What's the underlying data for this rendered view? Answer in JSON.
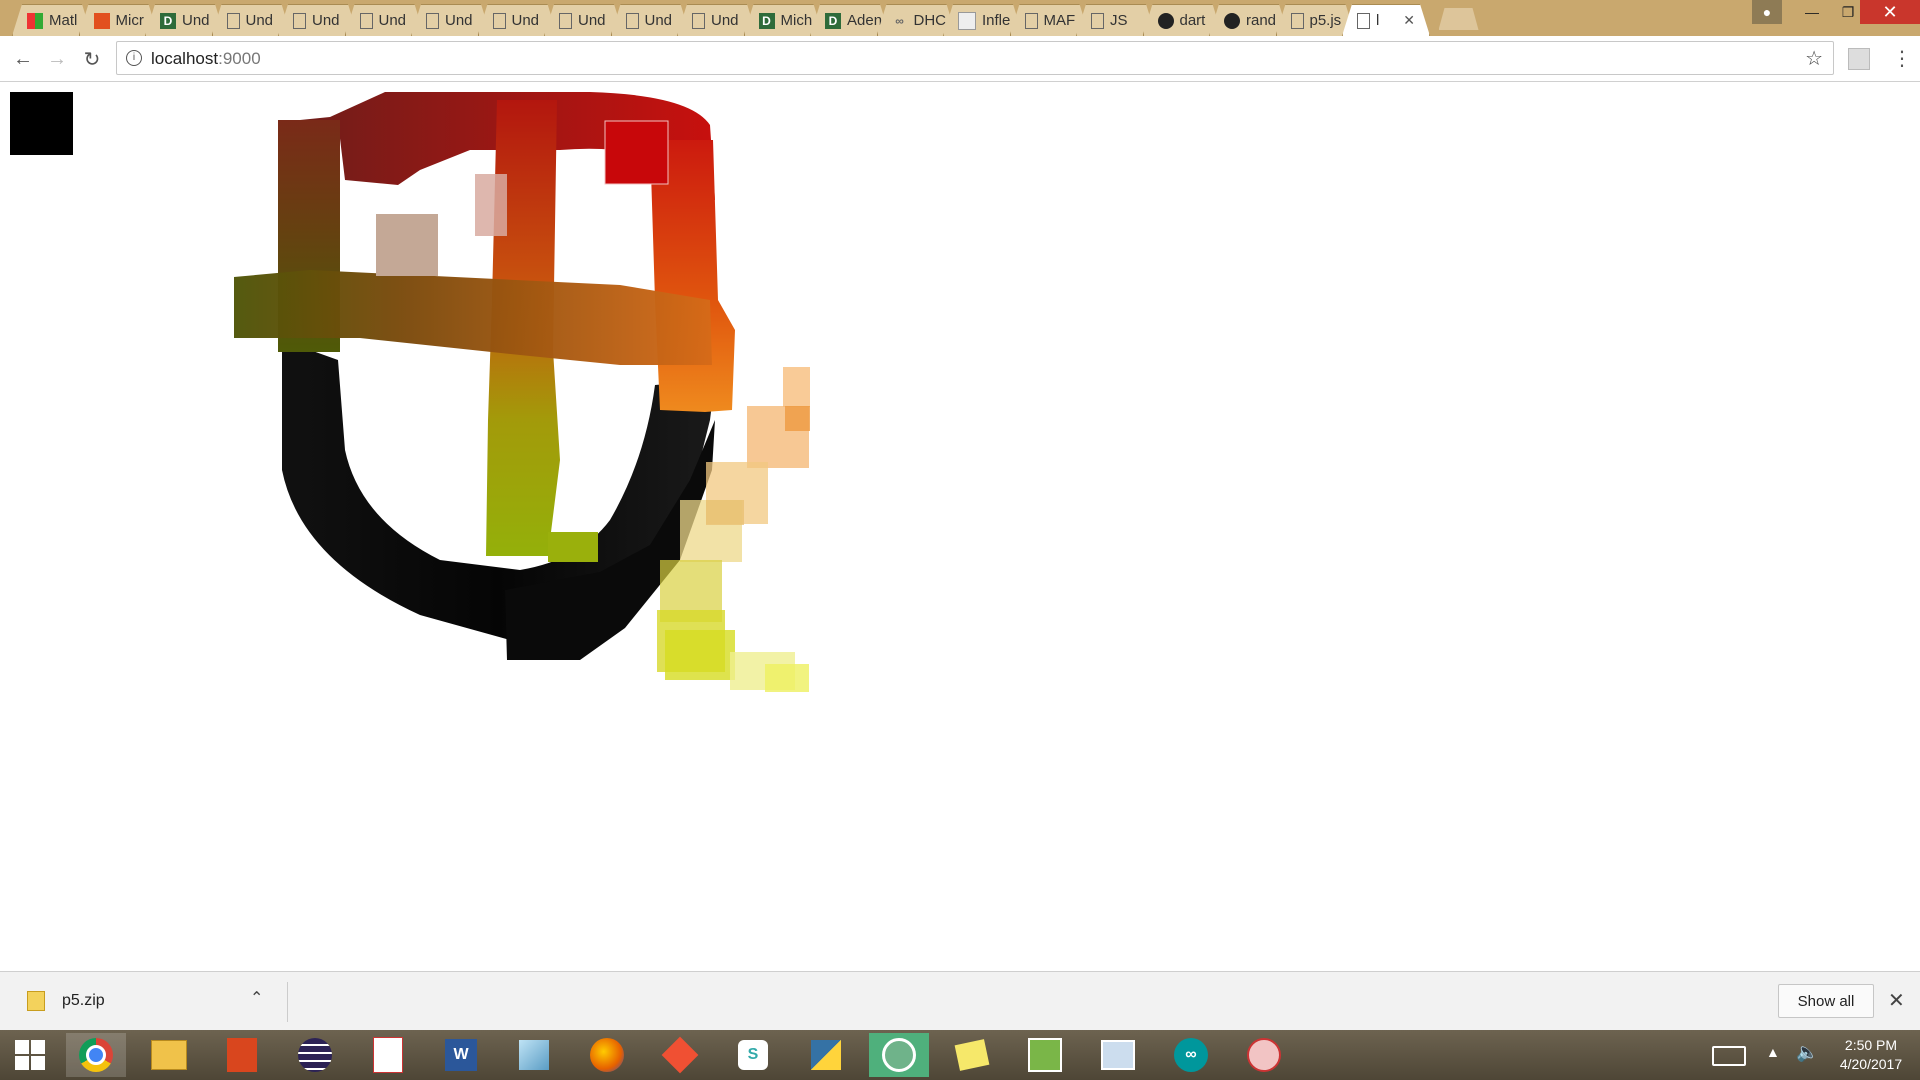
{
  "tabs": [
    {
      "label": "Matl",
      "icon": "multicolor-grid-icon",
      "color": "#d23b2a"
    },
    {
      "label": "Micr",
      "icon": "office-icon",
      "color": "#e2501f"
    },
    {
      "label": "Und",
      "icon": "d-icon",
      "color": "#2e6b3a"
    },
    {
      "label": "Und",
      "icon": "page-icon",
      "color": "#666666"
    },
    {
      "label": "Und",
      "icon": "page-icon",
      "color": "#666666"
    },
    {
      "label": "Und",
      "icon": "page-icon",
      "color": "#666666"
    },
    {
      "label": "Und",
      "icon": "page-icon",
      "color": "#666666"
    },
    {
      "label": "Und",
      "icon": "page-icon",
      "color": "#666666"
    },
    {
      "label": "Und",
      "icon": "page-icon",
      "color": "#666666"
    },
    {
      "label": "Und",
      "icon": "page-icon",
      "color": "#666666"
    },
    {
      "label": "Und",
      "icon": "page-icon",
      "color": "#666666"
    },
    {
      "label": "Mich",
      "icon": "d-icon",
      "color": "#2e6b3a"
    },
    {
      "label": "Aden",
      "icon": "d-icon",
      "color": "#2e6b3a"
    },
    {
      "label": "DHC",
      "icon": "link-icon",
      "color": "#666666"
    },
    {
      "label": "Infle",
      "icon": "image-icon",
      "color": "#999999"
    },
    {
      "label": "MAF",
      "icon": "page-icon",
      "color": "#666666"
    },
    {
      "label": "JS",
      "icon": "page-icon",
      "color": "#666666"
    },
    {
      "label": "dart",
      "icon": "github-icon",
      "color": "#222222"
    },
    {
      "label": "rand",
      "icon": "github-icon",
      "color": "#222222"
    },
    {
      "label": "p5.js",
      "icon": "page-icon",
      "color": "#666666"
    },
    {
      "label": "l",
      "icon": "page-icon",
      "color": "#666666",
      "active": true
    }
  ],
  "address_bar": {
    "url_host": "localhost",
    "url_port": ":9000"
  },
  "downloads_bar": {
    "file_name": "p5.zip",
    "show_all_label": "Show all"
  },
  "clock": {
    "time": "2:50 PM",
    "date": "4/20/2017"
  },
  "taskbar_apps": [
    "windows-start-icon",
    "chrome-icon",
    "file-explorer-icon",
    "office-upload-icon",
    "eclipse-icon",
    "pdf-reader-icon",
    "word-icon",
    "notepad-icon",
    "firefox-icon",
    "git-icon",
    "slack-icon",
    "python-icon",
    "atom-icon",
    "sticky-notes-icon",
    "image-viewer-icon",
    "resource-monitor-icon",
    "arduino-icon",
    "snipping-tool-icon"
  ],
  "colors": {
    "tabstrip": "#c9a86e",
    "taskbar": "#5a5140",
    "canvas_bg": "#ffffff"
  }
}
